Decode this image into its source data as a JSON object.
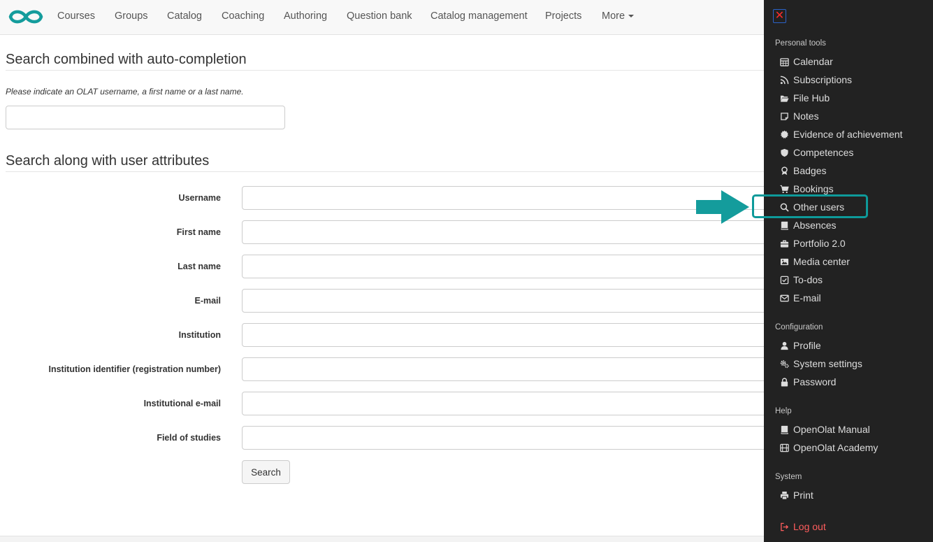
{
  "nav": {
    "items": [
      {
        "label": "Courses"
      },
      {
        "label": "Groups"
      },
      {
        "label": "Catalog"
      },
      {
        "label": "Coaching"
      },
      {
        "label": "Authoring"
      },
      {
        "label": "Question bank"
      },
      {
        "label": "Catalog management"
      },
      {
        "label": "Projects"
      },
      {
        "label": "More"
      }
    ]
  },
  "main": {
    "section1_title": "Search combined with auto-completion",
    "hint": "Please indicate an OLAT username, a first name or a last name.",
    "autocomplete_value": "",
    "section2_title": "Search along with user attributes",
    "fields": [
      {
        "label": "Username",
        "value": ""
      },
      {
        "label": "First name",
        "value": ""
      },
      {
        "label": "Last name",
        "value": ""
      },
      {
        "label": "E-mail",
        "value": ""
      },
      {
        "label": "Institution",
        "value": ""
      },
      {
        "label": "Institution identifier (registration number)",
        "value": ""
      },
      {
        "label": "Institutional e-mail",
        "value": ""
      },
      {
        "label": "Field of studies",
        "value": ""
      }
    ],
    "search_button": "Search"
  },
  "panel": {
    "groups": {
      "personal": "Personal tools",
      "config": "Configuration",
      "help": "Help",
      "system": "System"
    },
    "personal_items": [
      {
        "label": "Calendar",
        "icon": "calendar-icon"
      },
      {
        "label": "Subscriptions",
        "icon": "rss-icon"
      },
      {
        "label": "File Hub",
        "icon": "folder-open-icon"
      },
      {
        "label": "Notes",
        "icon": "note-icon"
      },
      {
        "label": "Evidence of achievement",
        "icon": "certificate-icon"
      },
      {
        "label": "Competences",
        "icon": "shield-icon"
      },
      {
        "label": "Badges",
        "icon": "award-icon"
      },
      {
        "label": "Bookings",
        "icon": "cart-icon"
      },
      {
        "label": "Other users",
        "icon": "search-icon"
      },
      {
        "label": "Absences",
        "icon": "book-icon"
      },
      {
        "label": "Portfolio 2.0",
        "icon": "briefcase-icon"
      },
      {
        "label": "Media center",
        "icon": "image-icon"
      },
      {
        "label": "To-dos",
        "icon": "check-square-icon"
      },
      {
        "label": "E-mail",
        "icon": "envelope-icon"
      }
    ],
    "config_items": [
      {
        "label": "Profile",
        "icon": "user-icon"
      },
      {
        "label": "System settings",
        "icon": "gears-icon"
      },
      {
        "label": "Password",
        "icon": "lock-icon"
      }
    ],
    "help_items": [
      {
        "label": "OpenOlat Manual",
        "icon": "book-icon"
      },
      {
        "label": "OpenOlat Academy",
        "icon": "film-icon"
      }
    ],
    "system_items": [
      {
        "label": "Print",
        "icon": "print-icon"
      }
    ],
    "logout": {
      "label": "Log out",
      "icon": "logout-icon"
    }
  },
  "colors": {
    "brand": "#149c9c",
    "panel_bg": "#222222",
    "highlight": "#0e9a9a",
    "logout": "#ff5d5d"
  }
}
